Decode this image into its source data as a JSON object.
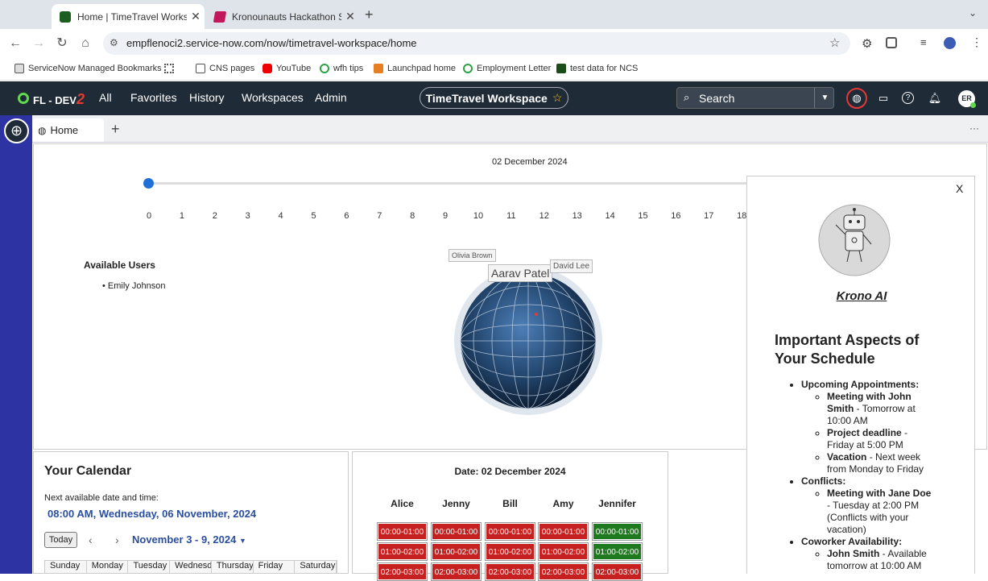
{
  "browser": {
    "tabs": [
      {
        "title": "Home | TimeTravel Workspace",
        "active": true
      },
      {
        "title": "Kronounauts Hackathon Subm",
        "active": false
      }
    ],
    "new_tab": "+",
    "url": "empflenoci2.service-now.com/now/timetravel-workspace/home",
    "bookmarks": [
      "ServiceNow Managed Bookmarks",
      "CNS pages",
      "YouTube",
      "wfh tips",
      "Launchpad home",
      "Employment Letter",
      "test data for NCS"
    ]
  },
  "sn_header": {
    "logo": "FL - DEV",
    "logo_num": "2",
    "nav": [
      "All",
      "Favorites",
      "History",
      "Workspaces",
      "Admin"
    ],
    "workspace": "TimeTravel Workspace",
    "search_placeholder": "Search",
    "avatar": "ER"
  },
  "app_tabs": {
    "home": "Home",
    "add": "+",
    "more": "···"
  },
  "timeline": {
    "date": "02 December 2024",
    "ticks": [
      "0",
      "1",
      "2",
      "3",
      "4",
      "5",
      "6",
      "7",
      "8",
      "9",
      "10",
      "11",
      "12",
      "13",
      "14",
      "15",
      "16",
      "17",
      "18"
    ],
    "value": 0
  },
  "available_users": {
    "title": "Available Users",
    "users": [
      "Emily Johnson"
    ]
  },
  "globe_labels": [
    "Olivia Brown",
    "Aarav Patel",
    "David Lee"
  ],
  "krono": {
    "close": "X",
    "name": "Krono AI",
    "heading_line1": "Important Aspects of",
    "heading_line2": "Your Schedule",
    "sections": [
      {
        "title": "Upcoming Appointments:",
        "items": [
          {
            "bold": "Meeting with John Smith",
            "rest": " - Tomorrow at 10:00 AM"
          },
          {
            "bold": "Project deadline",
            "rest": " - Friday at 5:00 PM"
          },
          {
            "bold": "Vacation",
            "rest": " - Next week from Monday to Friday"
          }
        ]
      },
      {
        "title": "Conflicts:",
        "items": [
          {
            "bold": "Meeting with Jane Doe",
            "rest": " - Tuesday at 2:00 PM (Conflicts with your vacation)"
          }
        ]
      },
      {
        "title": "Coworker Availability:",
        "items": [
          {
            "bold": "John Smith",
            "rest": " - Available tomorrow at 10:00 AM"
          }
        ]
      }
    ]
  },
  "calendar": {
    "title": "Your Calendar",
    "next_label": "Next available date and time:",
    "next_value": "08:00 AM, Wednesday, 06 November, 2024",
    "today": "Today",
    "range": "November 3 - 9, 2024",
    "days": [
      "Sunday",
      "Monday",
      "Tuesday",
      "Wednesday",
      "Thursday",
      "Friday",
      "Saturday"
    ]
  },
  "availability": {
    "date": "Date: 02 December 2024",
    "people": [
      "Alice",
      "Jenny",
      "Bill",
      "Amy",
      "Jennifer"
    ],
    "rows": [
      {
        "slot": "00:00-01:00",
        "status": [
          "busy",
          "busy",
          "busy",
          "busy",
          "free"
        ]
      },
      {
        "slot": "01:00-02:00",
        "status": [
          "busy",
          "busy",
          "busy",
          "busy",
          "free"
        ]
      },
      {
        "slot": "02:00-03:00",
        "status": [
          "busy",
          "busy",
          "busy",
          "busy",
          "busy"
        ]
      }
    ],
    "colors": {
      "busy": "#c62020",
      "free": "#1f7a1f"
    }
  }
}
